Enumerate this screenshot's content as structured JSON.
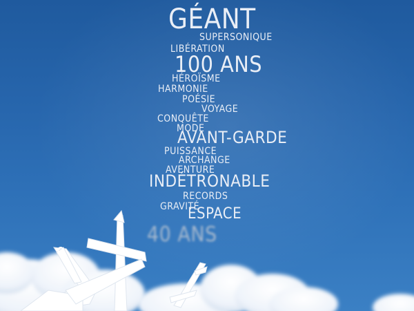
{
  "words": [
    "GÉANT",
    "SUPERSONIQUE",
    "LIBÉRATION",
    "100 ANS",
    "HÉROÏSME",
    "HARMONIE",
    "POÉSIE",
    "VOYAGE",
    "CONQUÊTE",
    "MODE",
    "AVANT-GARDE",
    "PUISSANCE",
    "ARCHANGE",
    "AVENTURE",
    "INDÉTRONABLE",
    "RECORDS",
    "GRAVITÉ",
    "ESPACE",
    "40 ANS"
  ],
  "colors": {
    "sky_top": "#1f5a9e",
    "sky_bottom": "#3b80c4",
    "text": "#e9eef6",
    "cloud": "#ffffff"
  }
}
